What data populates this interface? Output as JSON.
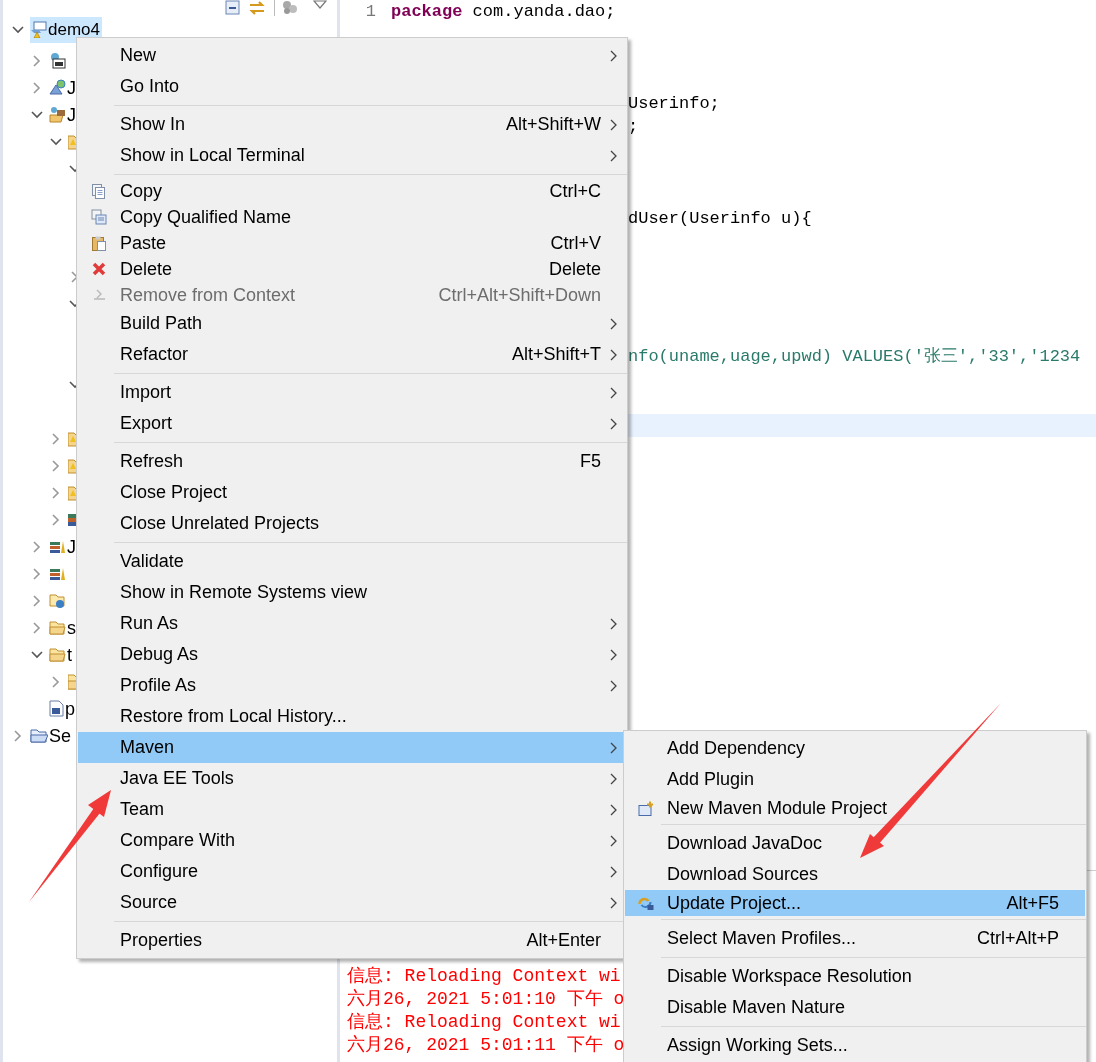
{
  "explorer": {
    "tree": [
      {
        "label": "demo4",
        "expanded": true,
        "selected": true,
        "children": [
          {
            "expanded": false,
            "selected": false
          },
          {
            "label": "J",
            "expanded": false,
            "selected": false
          },
          {
            "label": "J",
            "expanded": true,
            "selected": false,
            "children": [
              {
                "expanded": true,
                "selected": false,
                "children": [
                  {
                    "expanded": true
                  },
                  {
                    "expanded": false
                  },
                  {
                    "expanded": true
                  },
                  {
                    "expanded": true
                  }
                ]
              },
              {
                "expanded": false,
                "selected": false
              },
              {
                "expanded": false,
                "selected": false
              },
              {
                "expanded": false,
                "selected": false
              },
              {
                "expanded": false,
                "selected": false
              }
            ]
          },
          {
            "label": "J",
            "expanded": false,
            "selected": false
          },
          {
            "expanded": false,
            "selected": false
          },
          {
            "expanded": false,
            "selected": false
          },
          {
            "label": "s",
            "expanded": false,
            "selected": false
          },
          {
            "label": "t",
            "expanded": true,
            "selected": false,
            "children": [
              {
                "expanded": false,
                "selected": false
              }
            ]
          },
          {
            "label": "p",
            "selected": false
          }
        ]
      },
      {
        "label": "Se",
        "expanded": false,
        "selected": false
      }
    ]
  },
  "editor": {
    "lines": [
      {
        "number": "1",
        "current": false,
        "tokens": [
          {
            "text": "package",
            "kind": "keyword"
          },
          {
            "text": " com.yanda.dao;",
            "kind": "plain"
          }
        ]
      },
      {
        "current": false,
        "tokens": [
          {
            "text": "Userinfo;",
            "kind": "plain"
          }
        ]
      },
      {
        "current": false,
        "tokens": [
          {
            "text": ";",
            "kind": "plain"
          }
        ]
      },
      {
        "current": false,
        "tokens": [
          {
            "text": "dUser(Userinfo u){",
            "kind": "plain"
          }
        ]
      },
      {
        "current": false,
        "tokens": [
          {
            "text": "nfo(uname,uage,upwd) VALUES('张三','33','1234",
            "kind": "string"
          }
        ]
      },
      {
        "current": true
      }
    ]
  },
  "console": {
    "lines": [
      "信息: Reloading Context wi",
      "六月26, 2021 5:01:10 下午 o",
      "信息: Reloading Context wi",
      "六月26, 2021 5:01:11 下午 o"
    ]
  },
  "context_menu": {
    "items": [
      {
        "kind": "item",
        "label": "New",
        "submenu": true,
        "disabled": false,
        "selected": false
      },
      {
        "kind": "item",
        "label": "Go Into",
        "submenu": false,
        "disabled": false,
        "selected": false
      },
      {
        "kind": "separator"
      },
      {
        "kind": "item",
        "label": "Show In",
        "shortcut": "Alt+Shift+W",
        "submenu": true,
        "disabled": false,
        "selected": false
      },
      {
        "kind": "item",
        "label": "Show in Local Terminal",
        "submenu": true,
        "disabled": false,
        "selected": false
      },
      {
        "kind": "separator"
      },
      {
        "kind": "item",
        "label": "Copy",
        "shortcut": "Ctrl+C",
        "submenu": false,
        "disabled": false,
        "selected": false
      },
      {
        "kind": "item",
        "label": "Copy Qualified Name",
        "submenu": false,
        "disabled": false,
        "selected": false
      },
      {
        "kind": "item",
        "label": "Paste",
        "shortcut": "Ctrl+V",
        "submenu": false,
        "disabled": false,
        "selected": false
      },
      {
        "kind": "item",
        "label": "Delete",
        "shortcut": "Delete",
        "submenu": false,
        "disabled": false,
        "selected": false
      },
      {
        "kind": "item",
        "label": "Remove from Context",
        "shortcut": "Ctrl+Alt+Shift+Down",
        "submenu": false,
        "disabled": true,
        "selected": false
      },
      {
        "kind": "item",
        "label": "Build Path",
        "submenu": true,
        "disabled": false,
        "selected": false
      },
      {
        "kind": "item",
        "label": "Refactor",
        "shortcut": "Alt+Shift+T",
        "submenu": true,
        "disabled": false,
        "selected": false
      },
      {
        "kind": "separator"
      },
      {
        "kind": "item",
        "label": "Import",
        "submenu": true,
        "disabled": false,
        "selected": false
      },
      {
        "kind": "item",
        "label": "Export",
        "submenu": true,
        "disabled": false,
        "selected": false
      },
      {
        "kind": "separator"
      },
      {
        "kind": "item",
        "label": "Refresh",
        "shortcut": "F5",
        "submenu": false,
        "disabled": false,
        "selected": false
      },
      {
        "kind": "item",
        "label": "Close Project",
        "submenu": false,
        "disabled": false,
        "selected": false
      },
      {
        "kind": "item",
        "label": "Close Unrelated Projects",
        "submenu": false,
        "disabled": false,
        "selected": false
      },
      {
        "kind": "separator"
      },
      {
        "kind": "item",
        "label": "Validate",
        "submenu": false,
        "disabled": false,
        "selected": false
      },
      {
        "kind": "item",
        "label": "Show in Remote Systems view",
        "submenu": false,
        "disabled": false,
        "selected": false
      },
      {
        "kind": "item",
        "label": "Run As",
        "submenu": true,
        "disabled": false,
        "selected": false
      },
      {
        "kind": "item",
        "label": "Debug As",
        "submenu": true,
        "disabled": false,
        "selected": false
      },
      {
        "kind": "item",
        "label": "Profile As",
        "submenu": true,
        "disabled": false,
        "selected": false
      },
      {
        "kind": "item",
        "label": "Restore from Local History...",
        "submenu": false,
        "disabled": false,
        "selected": false
      },
      {
        "kind": "item",
        "label": "Maven",
        "submenu": true,
        "disabled": false,
        "selected": true
      },
      {
        "kind": "item",
        "label": "Java EE Tools",
        "submenu": true,
        "disabled": false,
        "selected": false
      },
      {
        "kind": "item",
        "label": "Team",
        "submenu": true,
        "disabled": false,
        "selected": false
      },
      {
        "kind": "item",
        "label": "Compare With",
        "submenu": true,
        "disabled": false,
        "selected": false
      },
      {
        "kind": "item",
        "label": "Configure",
        "submenu": true,
        "disabled": false,
        "selected": false
      },
      {
        "kind": "item",
        "label": "Source",
        "submenu": true,
        "disabled": false,
        "selected": false
      },
      {
        "kind": "separator"
      },
      {
        "kind": "item",
        "label": "Properties",
        "shortcut": "Alt+Enter",
        "submenu": false,
        "disabled": false,
        "selected": false
      }
    ]
  },
  "maven_submenu": {
    "items": [
      {
        "kind": "item",
        "label": "Add Dependency",
        "selected": false
      },
      {
        "kind": "item",
        "label": "Add Plugin",
        "selected": false
      },
      {
        "kind": "item",
        "label": "New Maven Module Project",
        "selected": false
      },
      {
        "kind": "separator"
      },
      {
        "kind": "item",
        "label": "Download JavaDoc",
        "selected": false
      },
      {
        "kind": "item",
        "label": "Download Sources",
        "selected": false
      },
      {
        "kind": "item",
        "label": "Update Project...",
        "shortcut": "Alt+F5",
        "selected": true
      },
      {
        "kind": "separator"
      },
      {
        "kind": "item",
        "label": "Select Maven Profiles...",
        "shortcut": "Ctrl+Alt+P",
        "selected": false
      },
      {
        "kind": "separator"
      },
      {
        "kind": "item",
        "label": "Disable Workspace Resolution",
        "selected": false
      },
      {
        "kind": "item",
        "label": "Disable Maven Nature",
        "selected": false
      },
      {
        "kind": "separator"
      },
      {
        "kind": "item",
        "label": "Assign Working Sets...",
        "selected": false
      }
    ]
  }
}
